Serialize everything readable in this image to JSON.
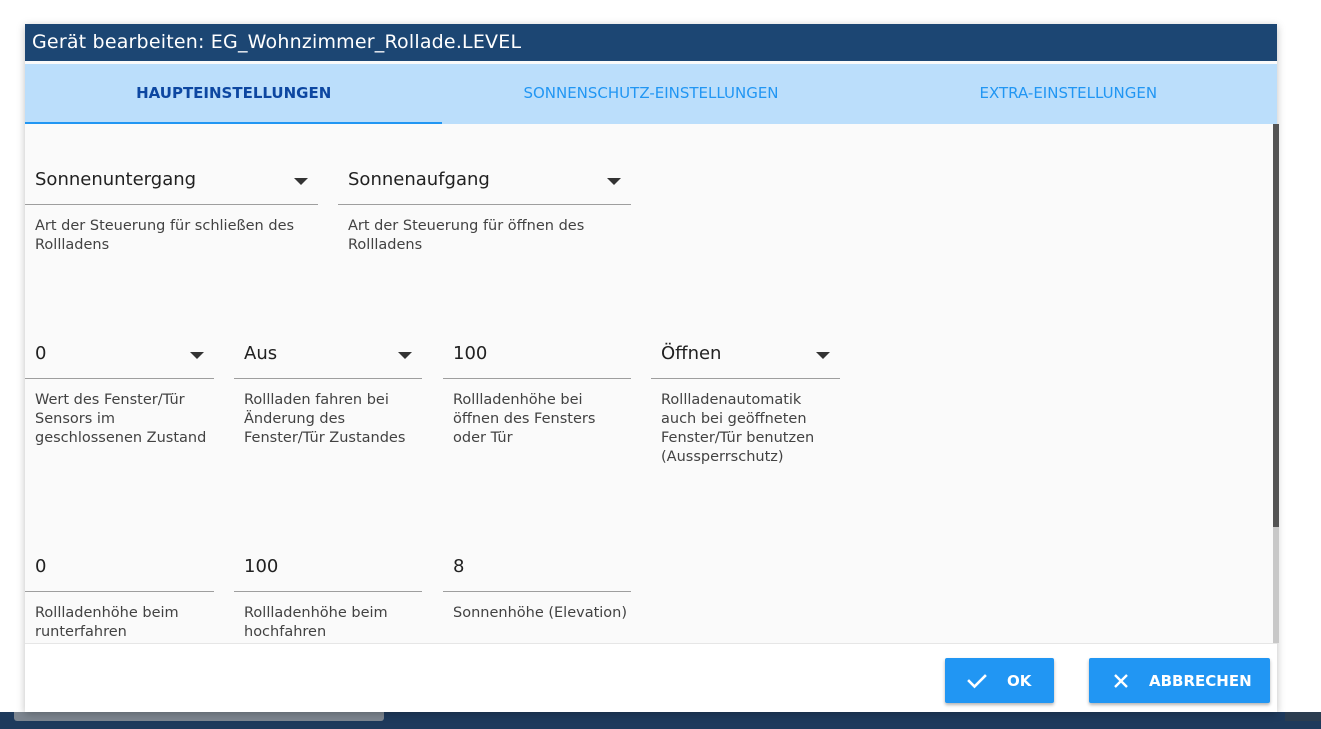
{
  "dialog": {
    "title": "Gerät bearbeiten: EG_Wohnzimmer_Rollade.LEVEL"
  },
  "tabs": [
    {
      "label": "HAUPTEINSTELLUNGEN",
      "active": true
    },
    {
      "label": "SONNENSCHUTZ-EINSTELLUNGEN",
      "active": false
    },
    {
      "label": "EXTRA-EINSTELLUNGEN",
      "active": false
    }
  ],
  "fields": {
    "close_type": {
      "value": "Sonnenuntergang",
      "helper": "Art der Steuerung für schließen des Rollladens"
    },
    "open_type": {
      "value": "Sonnenaufgang",
      "helper": "Art der Steuerung für öffnen des Rollladens"
    },
    "window_sensor_value": {
      "value": "0",
      "helper": "Wert des Fenster/Tür Sensors im geschlossenen Zustand"
    },
    "move_on_window_change": {
      "value": "Aus",
      "helper": "Rollladen fahren bei Änderung des Fenster/Tür Zustandes"
    },
    "height_window_open": {
      "value": "100",
      "helper": "Rollladenhöhe bei öffnen des Fensters oder Tür"
    },
    "lockout_protection": {
      "value": "Öffnen",
      "helper": "Rollladenautomatik auch bei geöffneten Fenster/Tür benutzen (Aussperrschutz)"
    },
    "height_down": {
      "value": "0",
      "helper": "Rollladenhöhe beim runterfahren"
    },
    "height_up": {
      "value": "100",
      "helper": "Rollladenhöhe beim hochfahren"
    },
    "sun_elevation": {
      "value": "8",
      "helper": "Sonnenhöhe (Elevation)"
    }
  },
  "footer": {
    "ok_label": "OK",
    "cancel_label": "ABBRECHEN"
  },
  "colors": {
    "title_bar": "#1c4673",
    "tabs_bg": "#bbdefb",
    "accent": "#2196f3",
    "active_tab": "#0d47a1"
  },
  "icons": {
    "ok": "check-icon",
    "cancel": "close-icon"
  }
}
